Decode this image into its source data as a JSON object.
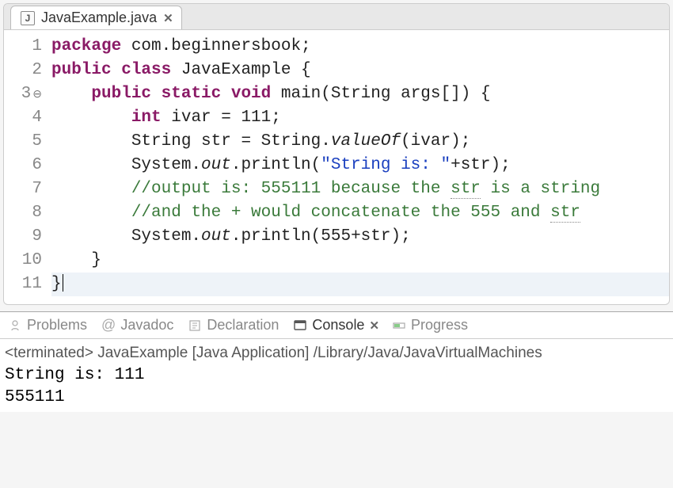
{
  "editor": {
    "tab": {
      "filename": "JavaExample.java"
    },
    "lines": [
      {
        "n": "1",
        "segs": [
          {
            "t": "package",
            "c": "kw"
          },
          {
            "t": " com.beginnersbook;",
            "c": ""
          }
        ]
      },
      {
        "n": "2",
        "segs": [
          {
            "t": "public class",
            "c": "kw"
          },
          {
            "t": " JavaExample {",
            "c": ""
          }
        ]
      },
      {
        "n": "3",
        "fold": true,
        "segs": [
          {
            "t": "    ",
            "c": ""
          },
          {
            "t": "public static void",
            "c": "kw"
          },
          {
            "t": " main(String args[]) {",
            "c": ""
          }
        ]
      },
      {
        "n": "4",
        "segs": [
          {
            "t": "        ",
            "c": ""
          },
          {
            "t": "int",
            "c": "kw"
          },
          {
            "t": " ivar = 111;",
            "c": ""
          }
        ]
      },
      {
        "n": "5",
        "segs": [
          {
            "t": "        String str = String.",
            "c": ""
          },
          {
            "t": "valueOf",
            "c": "ital"
          },
          {
            "t": "(ivar);",
            "c": ""
          }
        ]
      },
      {
        "n": "6",
        "segs": [
          {
            "t": "        System.",
            "c": ""
          },
          {
            "t": "out",
            "c": "ital"
          },
          {
            "t": ".println(",
            "c": ""
          },
          {
            "t": "\"String is: \"",
            "c": "str"
          },
          {
            "t": "+str);",
            "c": ""
          }
        ]
      },
      {
        "n": "7",
        "segs": [
          {
            "t": "        ",
            "c": ""
          },
          {
            "t": "//output is: 555111 because the ",
            "c": "com"
          },
          {
            "t": "str",
            "c": "com underdot"
          },
          {
            "t": " is a string",
            "c": "com"
          }
        ]
      },
      {
        "n": "8",
        "segs": [
          {
            "t": "        ",
            "c": ""
          },
          {
            "t": "//and the + would concatenate the 555 and ",
            "c": "com"
          },
          {
            "t": "str",
            "c": "com underdot"
          }
        ]
      },
      {
        "n": "9",
        "segs": [
          {
            "t": "        System.",
            "c": ""
          },
          {
            "t": "out",
            "c": "ital"
          },
          {
            "t": ".println(555+str);",
            "c": ""
          }
        ]
      },
      {
        "n": "10",
        "segs": [
          {
            "t": "    }",
            "c": ""
          }
        ]
      },
      {
        "n": "11",
        "active": true,
        "cursor": true,
        "segs": [
          {
            "t": "}",
            "c": ""
          }
        ]
      }
    ]
  },
  "bottom": {
    "tabs": {
      "problems": "Problems",
      "javadoc": "Javadoc",
      "declaration": "Declaration",
      "console": "Console",
      "progress": "Progress"
    },
    "console": {
      "status": "<terminated> JavaExample [Java Application] /Library/Java/JavaVirtualMachines",
      "out": [
        "String is: 111",
        "555111"
      ]
    }
  }
}
